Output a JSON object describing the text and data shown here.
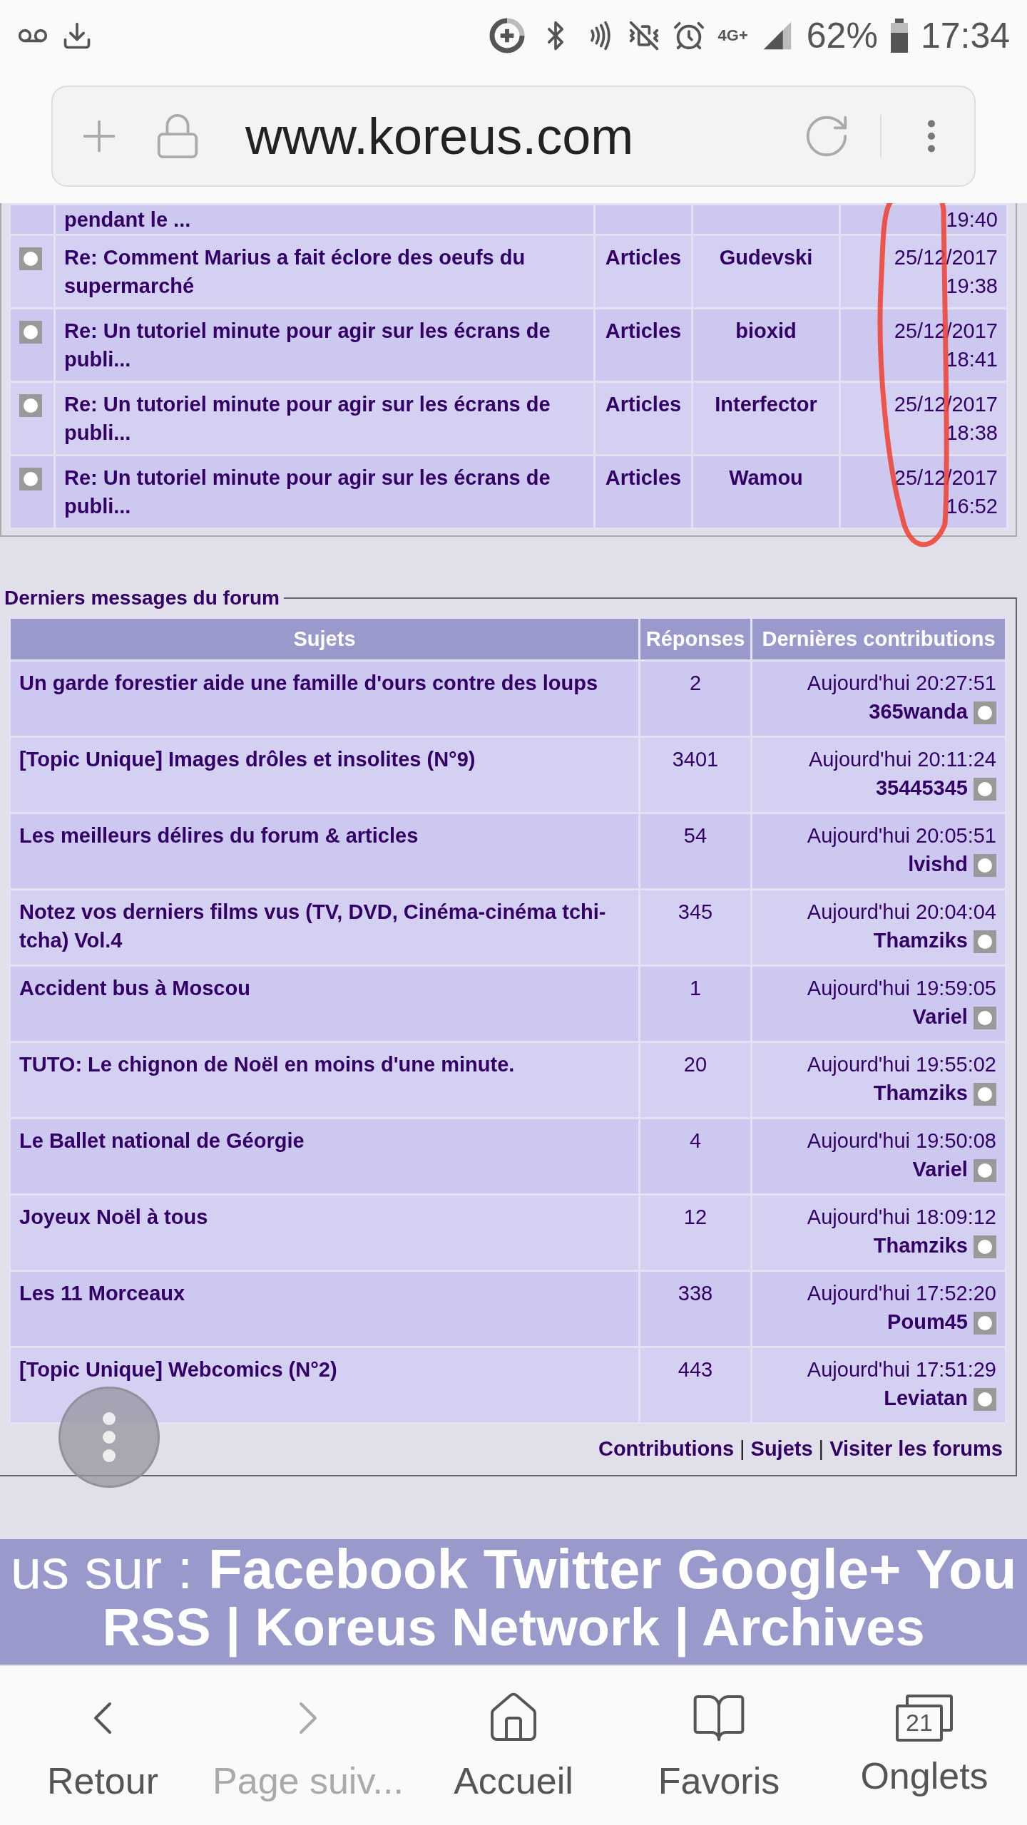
{
  "status_bar": {
    "network": "4G+",
    "battery": "62%",
    "time": "17:34"
  },
  "address_bar": {
    "url": "www.koreus.com"
  },
  "recent_articles": {
    "rows": [
      {
        "subject": "pendant le ...",
        "time": "19:40"
      },
      {
        "subject": "Re: Comment Marius a fait éclore des oeufs du supermarché",
        "category": "Articles",
        "author": "Gudevski",
        "date": "25/12/2017",
        "time": "19:38"
      },
      {
        "subject": "Re: Un tutoriel minute pour agir sur les écrans de publi...",
        "category": "Articles",
        "author": "bioxid",
        "date": "25/12/2017",
        "time": "18:41"
      },
      {
        "subject": "Re: Un tutoriel minute pour agir sur les écrans de publi...",
        "category": "Articles",
        "author": "Interfector",
        "date": "25/12/2017",
        "time": "18:38"
      },
      {
        "subject": "Re: Un tutoriel minute pour agir sur les écrans de publi...",
        "category": "Articles",
        "author": "Wamou",
        "date": "25/12/2017",
        "time": "16:52"
      }
    ]
  },
  "forum": {
    "legend": "Derniers messages du forum",
    "columns": [
      "Sujets",
      "Réponses",
      "Dernières contributions"
    ],
    "rows": [
      {
        "subject": "Un garde forestier aide une famille d'ours contre des loups",
        "replies": "2",
        "when": "Aujourd'hui 20:27:51",
        "user": "365wanda"
      },
      {
        "subject": "[Topic Unique] Images drôles et insolites (N°9)",
        "replies": "3401",
        "when": "Aujourd'hui 20:11:24",
        "user": "35445345"
      },
      {
        "subject": "Les meilleurs délires du forum & articles",
        "replies": "54",
        "when": "Aujourd'hui 20:05:51",
        "user": "lvishd"
      },
      {
        "subject": "Notez vos derniers films vus (TV, DVD, Cinéma-cinéma tchi-tcha) Vol.4",
        "replies": "345",
        "when": "Aujourd'hui 20:04:04",
        "user": "Thamziks"
      },
      {
        "subject": "Accident bus à Moscou",
        "replies": "1",
        "when": "Aujourd'hui 19:59:05",
        "user": "Variel"
      },
      {
        "subject": "TUTO: Le chignon de Noël en moins d'une minute.",
        "replies": "20",
        "when": "Aujourd'hui 19:55:02",
        "user": "Thamziks"
      },
      {
        "subject": "Le Ballet national de Géorgie",
        "replies": "4",
        "when": "Aujourd'hui 19:50:08",
        "user": "Variel"
      },
      {
        "subject": "Joyeux Noël à tous",
        "replies": "12",
        "when": "Aujourd'hui 18:09:12",
        "user": "Thamziks"
      },
      {
        "subject": "Les 11 Morceaux",
        "replies": "338",
        "when": "Aujourd'hui 17:52:20",
        "user": "Poum45"
      },
      {
        "subject": "[Topic Unique] Webcomics (N°2)",
        "replies": "443",
        "when": "Aujourd'hui 17:51:29",
        "user": "Leviatan"
      }
    ],
    "links": [
      "Contributions",
      "Sujets",
      "Visiter les forums"
    ],
    "separators": [
      "|",
      "|"
    ]
  },
  "banner": {
    "line_1": "us sur : **Facebook Twitter Google+ You**",
    "line_2": "RSS | Koreus Network | Archives"
  },
  "bottom_nav": [
    {
      "label": "Retour",
      "kind": "back",
      "disabled": false
    },
    {
      "label": "Page suiv...",
      "kind": "forward",
      "disabled": true
    },
    {
      "label": "Accueil",
      "kind": "home",
      "disabled": false
    },
    {
      "label": "Favoris",
      "kind": "bookmarks",
      "disabled": false
    },
    {
      "label": "Onglets",
      "kind": "tabs",
      "disabled": false,
      "count": "21"
    }
  ]
}
